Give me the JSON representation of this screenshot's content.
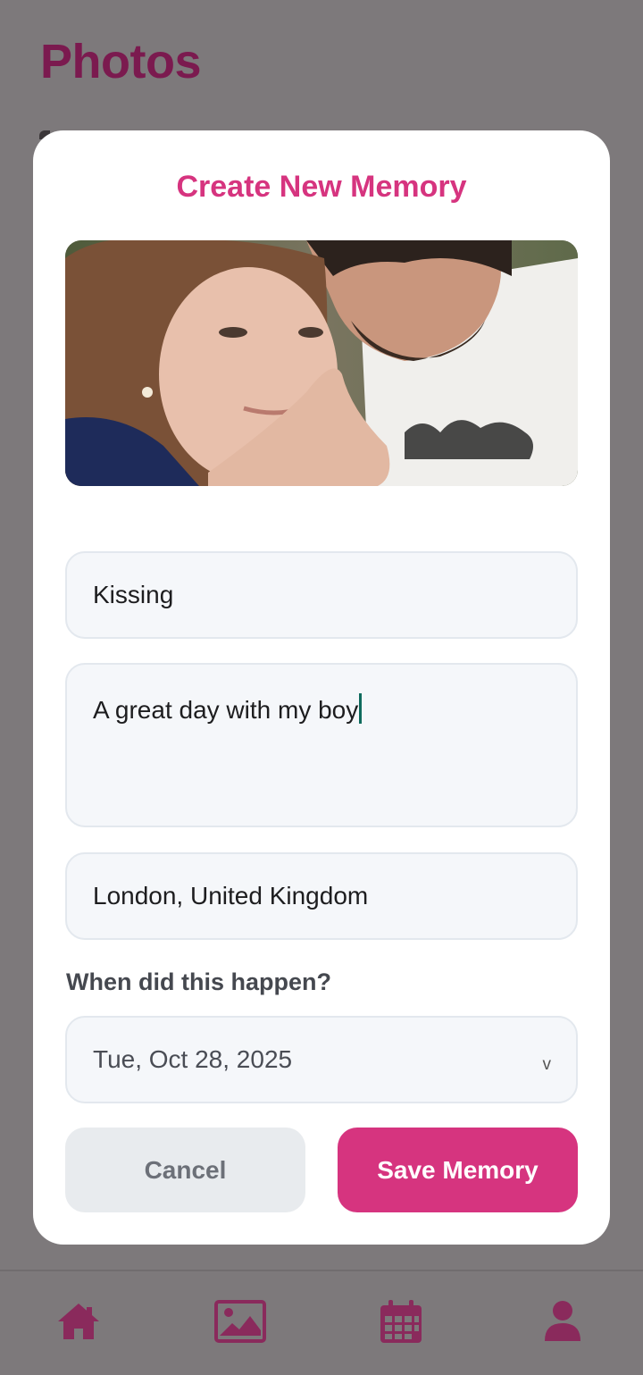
{
  "page": {
    "title": "Photos"
  },
  "modal": {
    "title": "Create New Memory",
    "photo_alt": "Couple selfie",
    "fields": {
      "title_value": "Kissing",
      "description_value": "A great day with my boy",
      "location_value": "London, United Kingdom"
    },
    "date": {
      "label": "When did this happen?",
      "value": "Tue, Oct 28, 2025",
      "chevron": "v"
    },
    "buttons": {
      "cancel": "Cancel",
      "save": "Save Memory"
    }
  },
  "nav": {
    "items": [
      {
        "icon": "home-icon"
      },
      {
        "icon": "photos-icon",
        "active": true
      },
      {
        "icon": "calendar-icon"
      },
      {
        "icon": "profile-icon"
      }
    ]
  },
  "colors": {
    "accent": "#d6347f",
    "title_dark": "#7b1a4f",
    "overlay": "#7d797b"
  }
}
